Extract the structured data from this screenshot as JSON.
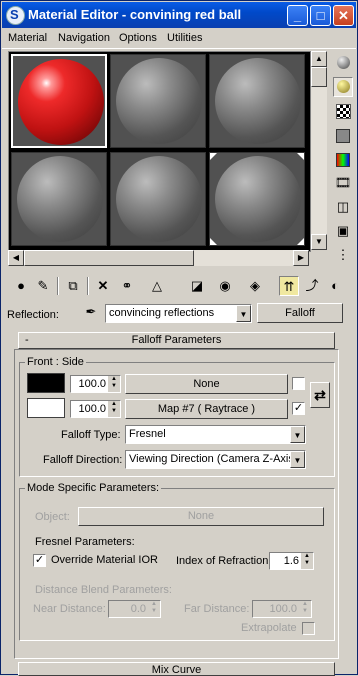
{
  "window": {
    "title": "Material Editor - convining red ball"
  },
  "titlebar_buttons": {
    "minimize": "_",
    "maximize": "□",
    "close": "✕"
  },
  "menu": [
    "Material",
    "Navigation",
    "Options",
    "Utilities"
  ],
  "sidebar_icons": [
    "sample-type-sphere-icon",
    "backlight-icon",
    "background-checker-icon",
    "sample-uv-tiling-icon",
    "video-color-check-icon",
    "make-preview-icon",
    "options-icon",
    "select-by-material-icon",
    "material-map-navigator-icon"
  ],
  "toolbar_icons": [
    "get-material-icon",
    "put-to-scene-icon",
    "assign-to-selection-icon",
    "reset-map-icon",
    "make-unique-icon",
    "put-to-library-icon",
    "material-id-channel-icon",
    "show-map-in-viewport-icon",
    "show-end-result-icon",
    "go-to-parent-icon",
    "go-forward-to-sibling-icon"
  ],
  "reflection": {
    "label": "Reflection:",
    "map_name": "convincing reflections",
    "type_button": "Falloff"
  },
  "falloff": {
    "header": "Falloff Parameters",
    "collapse": "-",
    "front_side_label": "Front : Side",
    "row1": {
      "color": "#000000",
      "amount": "100.0",
      "map": "None",
      "checked": false
    },
    "row2": {
      "color": "#ffffff",
      "amount": "100.0",
      "map": "Map #7  ( Raytrace )",
      "checked": true
    },
    "falloff_type_label": "Falloff Type:",
    "falloff_type": "Fresnel",
    "falloff_direction_label": "Falloff Direction:",
    "falloff_direction": "Viewing Direction (Camera Z-Axis)"
  },
  "mode_specific": {
    "title": "Mode Specific Parameters:",
    "object_label": "Object:",
    "object_button": "None",
    "fresnel_title": "Fresnel Parameters:",
    "override_label": "Override Material IOR",
    "override_checked": true,
    "ior_label": "Index of Refraction",
    "ior_value": "1.6",
    "distance_title": "Distance Blend Parameters:",
    "near_label": "Near Distance:",
    "near_value": "0.0",
    "far_label": "Far Distance:",
    "far_value": "100.0",
    "extrapolate_label": "Extrapolate",
    "extrapolate_checked": false
  },
  "bottom_rollout": "Mix Curve"
}
